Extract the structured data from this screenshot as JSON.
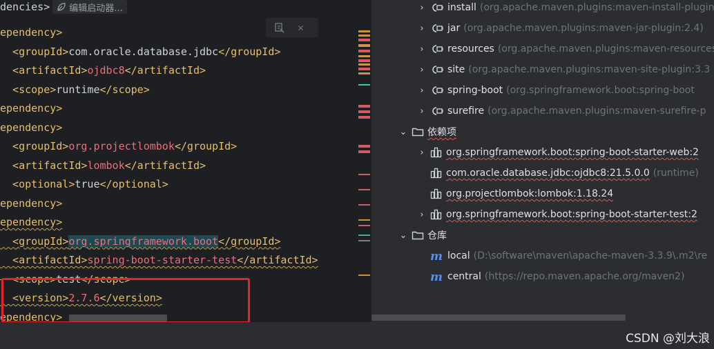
{
  "breadcrumb": {
    "text": "dencies>",
    "chip_label": "编辑启动器..."
  },
  "editor": {
    "close_symbol": "✕",
    "lines": [
      [
        {
          "t": "ependency>",
          "c": "tag"
        }
      ],
      [
        {
          "t": "  <groupId>",
          "c": "tag"
        },
        {
          "t": "com.oracle.database.jdbc",
          "c": "tx"
        },
        {
          "t": "</groupId>",
          "c": "tag"
        }
      ],
      [
        {
          "t": "  <artifactId>",
          "c": "tag"
        },
        {
          "t": "ojdbc8",
          "c": "red"
        },
        {
          "t": "</artifactId>",
          "c": "tag"
        }
      ],
      [
        {
          "t": "  <scope>",
          "c": "tag"
        },
        {
          "t": "runtime",
          "c": "tx"
        },
        {
          "t": "</scope>",
          "c": "tag"
        }
      ],
      [
        {
          "t": "ependency>",
          "c": "tag"
        }
      ],
      [
        {
          "t": "ependency>",
          "c": "tag"
        }
      ],
      [
        {
          "t": "  <groupId>",
          "c": "tag"
        },
        {
          "t": "org.projectlombok",
          "c": "red"
        },
        {
          "t": "</groupId>",
          "c": "tag"
        }
      ],
      [
        {
          "t": "  <artifactId>",
          "c": "tag"
        },
        {
          "t": "lombok",
          "c": "red"
        },
        {
          "t": "</artifactId>",
          "c": "tag"
        }
      ],
      [
        {
          "t": "  <optional>",
          "c": "tag"
        },
        {
          "t": "true",
          "c": "tx"
        },
        {
          "t": "</optional>",
          "c": "tag"
        }
      ],
      [
        {
          "t": "ependency>",
          "c": "tag"
        }
      ],
      [
        {
          "t": "ependency>",
          "c": "tag squig"
        }
      ],
      [
        {
          "t": "  <groupId>",
          "c": "tag squig"
        },
        {
          "t": "org.springframework.boot",
          "c": "red hl squig"
        },
        {
          "t": "</groupId>",
          "c": "tag squig"
        }
      ],
      [
        {
          "t": "  <artifactId>",
          "c": "tag squig"
        },
        {
          "t": "spring-boot-starter-test",
          "c": "red squig"
        },
        {
          "t": "</artifactId>",
          "c": "tag squig"
        }
      ],
      [
        {
          "t": "  <scope>",
          "c": "tag squig strike"
        },
        {
          "t": "test",
          "c": "tx squig strike"
        },
        {
          "t": "</scope>",
          "c": "tag squig strike"
        }
      ],
      [
        {
          "t": "  <version>",
          "c": "tag squig"
        },
        {
          "t": "2.7.6",
          "c": "red squig"
        },
        {
          "t": "</version>",
          "c": "tag squig"
        }
      ],
      [
        {
          "t": "ependency>",
          "c": "tag squig"
        }
      ]
    ]
  },
  "tree": {
    "rows": [
      {
        "indent": 1,
        "chev": "›",
        "icon": "plugin",
        "label": "install",
        "detail": "(org.apache.maven.plugins:maven-install-plugin"
      },
      {
        "indent": 1,
        "chev": "›",
        "icon": "plugin",
        "label": "jar",
        "detail": "(org.apache.maven.plugins:maven-jar-plugin:2.4)"
      },
      {
        "indent": 1,
        "chev": "›",
        "icon": "plugin",
        "label": "resources",
        "detail": "(org.apache.maven.plugins:maven-resources"
      },
      {
        "indent": 1,
        "chev": "›",
        "icon": "plugin",
        "label": "site",
        "detail": "(org.apache.maven.plugins:maven-site-plugin:3.3"
      },
      {
        "indent": 1,
        "chev": "›",
        "icon": "plugin",
        "label": "spring-boot",
        "detail": "(org.springframework.boot:spring-boot"
      },
      {
        "indent": 1,
        "chev": "›",
        "icon": "plugin",
        "label": "surefire",
        "detail": "(org.apache.maven.plugins:maven-surefire-p"
      },
      {
        "indent": 0,
        "chev": "⌄",
        "icon": "folder",
        "label": "依赖项",
        "detail": "",
        "wavy": true
      },
      {
        "indent": 1,
        "chev": "›",
        "icon": "dep",
        "label": "org.springframework.boot:spring-boot-starter-web:2",
        "detail": "",
        "wavy": true
      },
      {
        "indent": 1,
        "chev": "",
        "icon": "dep",
        "label": "com.oracle.database.jdbc:ojdbc8:21.5.0.0",
        "detail": "(runtime)",
        "wavy": true
      },
      {
        "indent": 1,
        "chev": "",
        "icon": "dep",
        "label": "org.projectlombok:lombok:1.18.24",
        "detail": "",
        "wavy": true
      },
      {
        "indent": 1,
        "chev": "›",
        "icon": "dep",
        "label": "org.springframework.boot:spring-boot-starter-test:2",
        "detail": "",
        "wavy": true
      },
      {
        "indent": 0,
        "chev": "⌄",
        "icon": "folder",
        "label": "仓库",
        "detail": ""
      },
      {
        "indent": 1,
        "chev": "",
        "icon": "repo",
        "label": "local",
        "detail": "(D:\\software\\maven\\apache-maven-3.3.9\\.m2\\re"
      },
      {
        "indent": 1,
        "chev": "",
        "icon": "repo",
        "label": "central",
        "detail": "(https://repo.maven.apache.org/maven2)"
      }
    ]
  },
  "watermark": "CSDN @刘大浪"
}
